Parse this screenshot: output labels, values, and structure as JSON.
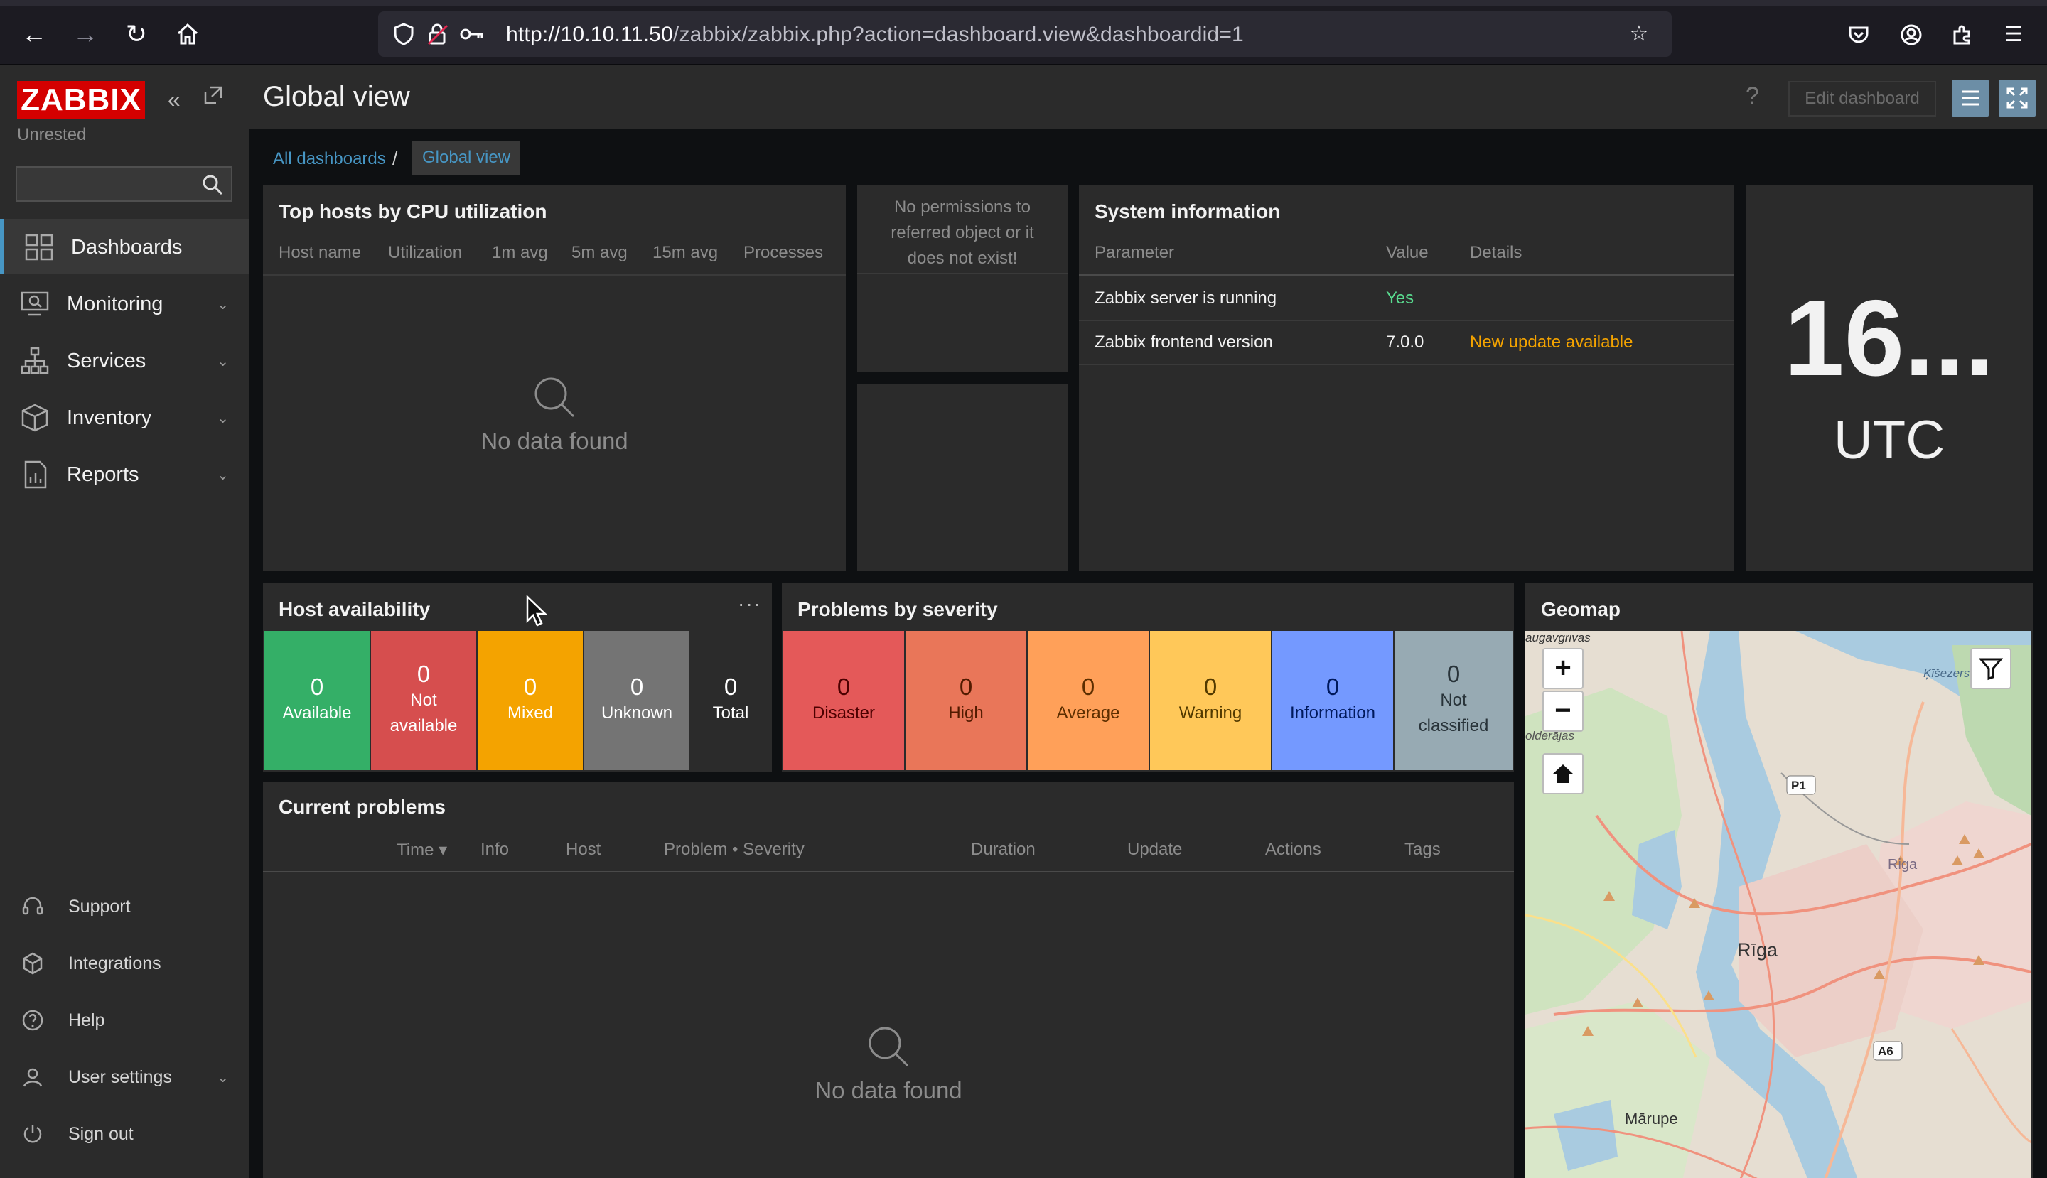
{
  "browser": {
    "url_host": "http://10.10.11.50",
    "url_path": "/zabbix/zabbix.php?action=dashboard.view&dashboardid=1",
    "icons": [
      "back-arrow-icon",
      "forward-arrow-icon",
      "reload-icon",
      "home-icon",
      "shield-icon",
      "lock-icon",
      "key-icon",
      "star-icon",
      "pocket-icon",
      "account-icon",
      "extensions-icon",
      "hamburger-menu-icon"
    ]
  },
  "sidebar": {
    "logo": "ZABBIX",
    "server_name": "Unrested",
    "search_placeholder": "",
    "menu": [
      {
        "label": "Dashboards",
        "icon": "dashboards-icon",
        "active": true
      },
      {
        "label": "Monitoring",
        "icon": "monitoring-icon"
      },
      {
        "label": "Services",
        "icon": "services-icon"
      },
      {
        "label": "Inventory",
        "icon": "inventory-icon"
      },
      {
        "label": "Reports",
        "icon": "reports-icon"
      }
    ],
    "footer": [
      {
        "label": "Support",
        "icon": "support-icon"
      },
      {
        "label": "Integrations",
        "icon": "integrations-icon"
      },
      {
        "label": "Help",
        "icon": "help-icon"
      },
      {
        "label": "User settings",
        "icon": "user-icon"
      },
      {
        "label": "Sign out",
        "icon": "power-icon"
      }
    ]
  },
  "header": {
    "title": "Global view",
    "help": "?",
    "edit_label": "Edit dashboard"
  },
  "breadcrumb": {
    "all": "All dashboards",
    "separator": "/",
    "current": "Global view"
  },
  "top_hosts": {
    "title": "Top hosts by CPU utilization",
    "columns": [
      "Host name",
      "Utilization",
      "1m avg",
      "5m avg",
      "15m avg",
      "Processes"
    ],
    "empty": "No data found"
  },
  "no_permission": {
    "line1": "No permissions to",
    "line2": "referred object or it",
    "line3": "does not exist!"
  },
  "system_info": {
    "title": "System information",
    "columns": [
      "Parameter",
      "Value",
      "Details"
    ],
    "rows": [
      {
        "parameter": "Zabbix server is running",
        "value": "Yes",
        "details": ""
      },
      {
        "parameter": "Zabbix frontend version",
        "value": "7.0.0",
        "details": "New update available"
      }
    ],
    "colors": {
      "yes": "#59db8f",
      "update": "#f4a300"
    }
  },
  "clock": {
    "time": "16...",
    "zone": "UTC"
  },
  "host_availability": {
    "title": "Host availability",
    "menu": "···",
    "tiles": [
      {
        "count": "0",
        "line1": "Available",
        "line2": "",
        "color": "#34af67"
      },
      {
        "count": "0",
        "line1": "Not",
        "line2": "available",
        "color": "#d64e4e"
      },
      {
        "count": "0",
        "line1": "Mixed",
        "line2": "",
        "color": "#f4a300"
      },
      {
        "count": "0",
        "line1": "Unknown",
        "line2": "",
        "color": "#747474"
      },
      {
        "count": "0",
        "line1": "Total",
        "line2": "",
        "color": "#2b2b2b"
      }
    ]
  },
  "problems_severity": {
    "title": "Problems by severity",
    "tiles": [
      {
        "count": "0",
        "line1": "Disaster",
        "line2": "",
        "color": "#e45959",
        "text": "#4c0000"
      },
      {
        "count": "0",
        "line1": "High",
        "line2": "",
        "color": "#e97659",
        "text": "#521a00"
      },
      {
        "count": "0",
        "line1": "Average",
        "line2": "",
        "color": "#ffa059",
        "text": "#5c2e00"
      },
      {
        "count": "0",
        "line1": "Warning",
        "line2": "",
        "color": "#ffc859",
        "text": "#523a00"
      },
      {
        "count": "0",
        "line1": "Information",
        "line2": "",
        "color": "#7499ff",
        "text": "#00195c"
      },
      {
        "count": "0",
        "line1": "Not",
        "line2": "classified",
        "color": "#97aab3",
        "text": "#283339"
      }
    ]
  },
  "geomap": {
    "title": "Geomap",
    "labels": {
      "city": "Rīga",
      "riga_en": "Riga",
      "marupe": "Mārupe",
      "kisezers": "Ķīšezers",
      "daugavgriva": "augavgrīvas",
      "bolderaja": "olderājas",
      "p1": "P1",
      "a6": "A6"
    },
    "zoom_in": "+",
    "zoom_out": "−"
  },
  "current_problems": {
    "title": "Current problems",
    "columns": [
      "Time ▾",
      "Info",
      "Host",
      "Problem • Severity",
      "Duration",
      "Update",
      "Actions",
      "Tags"
    ],
    "empty": "No data found"
  }
}
